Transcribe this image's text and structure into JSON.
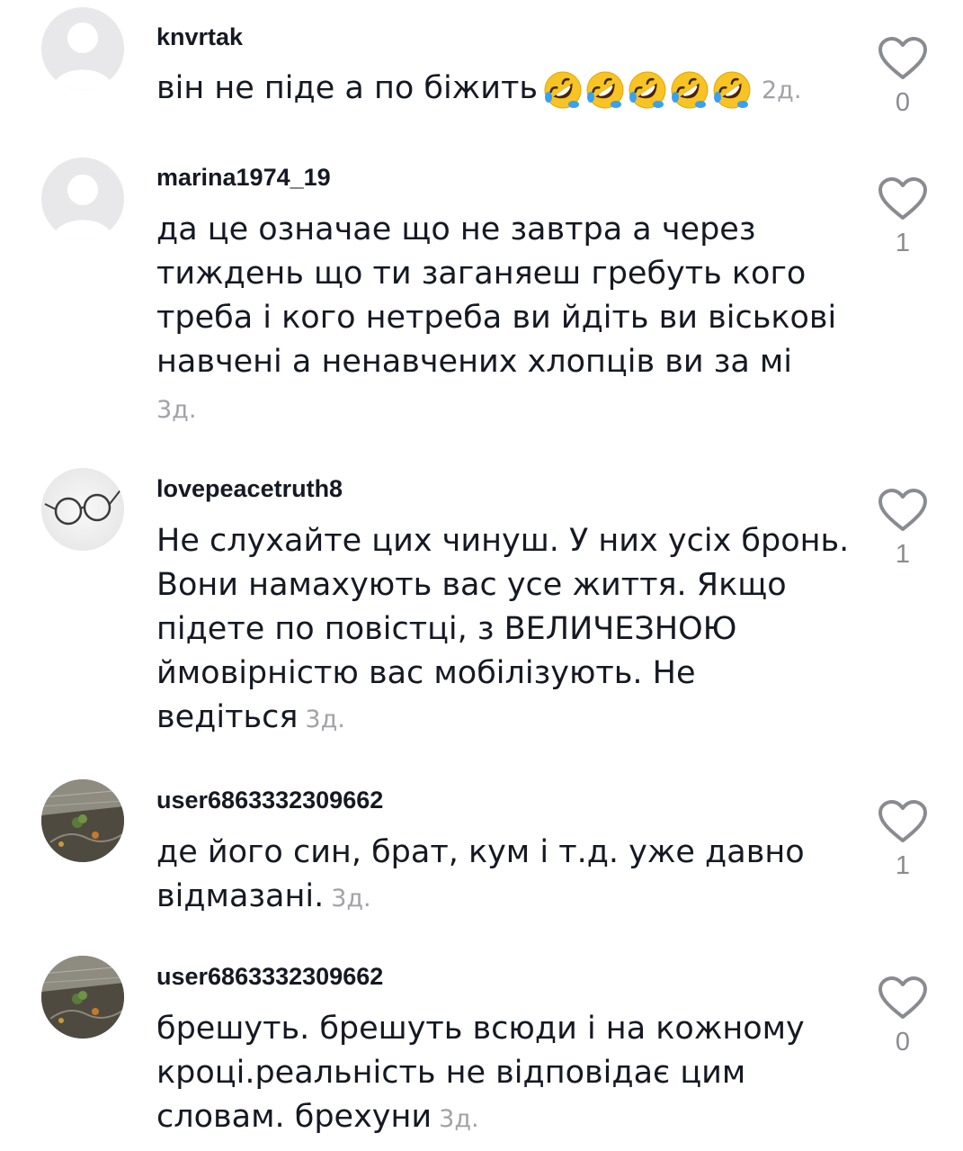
{
  "comments": [
    {
      "username": "knvrtak",
      "text": "він не піде а по біжить",
      "emojis": [
        "rofl-emoji",
        "rofl-emoji",
        "rofl-emoji",
        "rofl-emoji",
        "rofl-emoji"
      ],
      "time": "2д.",
      "likes": "0",
      "avatar": "default-avatar-icon"
    },
    {
      "username": "marina1974_19",
      "text": "да це означае що не завтра а через тиждень що ти заганяеш гребуть кого треба і кого нетреба ви йдіть ви віськові навчені а ненавчених хлопців ви за мі",
      "time": "3д.",
      "likes": "1",
      "avatar": "default-avatar-icon"
    },
    {
      "username": "lovepeacetruth8",
      "text": "Не слухайте цих чинуш. У них усіх бронь. Вони намахують вас усе життя. Якщо підете по повістці, з ВЕЛИЧЕЗНОЮ ймовірністю вас мобілізують. Не ведіться",
      "time": "3д.",
      "likes": "1",
      "avatar": "glasses-avatar"
    },
    {
      "username": "user6863332309662",
      "text": "де його син, брат, кум і т.д. уже давно відмазані.",
      "time": "3д.",
      "likes": "1",
      "avatar": "plant-photo-avatar"
    },
    {
      "username": "user6863332309662",
      "text": "брешуть. брешуть всюди і на кожному кроці.реальність не відповідає цим словам. брехуни",
      "time": "3д.",
      "likes": "0",
      "avatar": "plant-photo-avatar"
    }
  ],
  "colors": {
    "text": "#161823",
    "muted": "#a1a2a7",
    "icon": "#8a8b91"
  }
}
